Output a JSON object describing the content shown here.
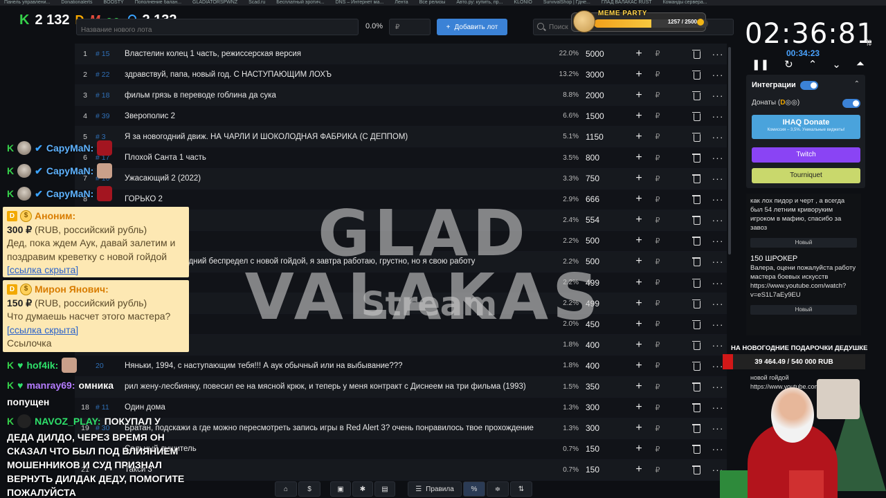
{
  "bookmarks": [
    "Панель управлени...",
    "Donationalerts",
    "BOOSTY",
    "Пополнение балан...",
    "GLADIATORSPWNZ",
    "Scad.ru",
    "Бесплатный эротич...",
    "DNS – Интернет ма...",
    "Лента",
    "Все релизы",
    "Авто.ру: купить, пр...",
    "KLONIO",
    "SurvivalShop | Гдне...",
    "ГЛАД ВАЛАКАС RUST",
    "Команды сервера..."
  ],
  "counters": {
    "left_value": "2 132",
    "right_value": "2 132"
  },
  "lot_form": {
    "name_placeholder": "Название нового лота",
    "percent": "0.0%",
    "currency": "₽",
    "add_button": "Добавить лот",
    "search_placeholder": "Поиск"
  },
  "meme_party": {
    "title": "MEME PARTY",
    "count": "1257 / 2500",
    "progress": 0.503
  },
  "table": {
    "rows": [
      {
        "n": "1",
        "id": "# 15",
        "name": "Властелин колец 1 часть, режиссерская версия",
        "pct": "22.0%",
        "amt": "5000"
      },
      {
        "n": "2",
        "id": "# 22",
        "name": "здравствуй, папа, новый год. С НАСТУПАЮЩИМ ЛОХЪ",
        "pct": "13.2%",
        "amt": "3000"
      },
      {
        "n": "3",
        "id": "# 18",
        "name": "фильм грязь в переводе гоблина да сука",
        "pct": "8.8%",
        "amt": "2000"
      },
      {
        "n": "4",
        "id": "# 39",
        "name": "Зверополис 2",
        "pct": "6.6%",
        "amt": "1500"
      },
      {
        "n": "5",
        "id": "# 3",
        "name": "Я за новогодний движ. НА ЧАРЛИ И ШОКОЛОДНАЯ ФАБРИКА (С ДЕППОМ)",
        "pct": "5.1%",
        "amt": "1150"
      },
      {
        "n": "6",
        "id": "# 17",
        "name": "Плохой Санта 1 часть",
        "pct": "3.5%",
        "amt": "800"
      },
      {
        "n": "7",
        "id": "# 10",
        "name": "Ужасающий 2 (2022)",
        "pct": "3.3%",
        "amt": "750"
      },
      {
        "n": "8",
        "id": "",
        "name": "ГОРЬКО 2",
        "pct": "2.9%",
        "amt": "666"
      },
      {
        "n": "",
        "id": "",
        "name": "итальянски 2003",
        "pct": "2.4%",
        "amt": "554"
      },
      {
        "n": "",
        "id": "",
        "name": "м совести 2016",
        "pct": "2.2%",
        "amt": "500"
      },
      {
        "n": "",
        "id": "",
        "name": "рублёвки. Новогодний беспредел с новой гойдой, я завтра работаю, грустно, но я свою работу",
        "pct": "2.2%",
        "amt": "500"
      },
      {
        "n": "",
        "id": "",
        "name": "",
        "pct": "2.2%",
        "amt": "499"
      },
      {
        "n": "",
        "id": "",
        "name": "",
        "pct": "2.2%",
        "amt": "499"
      },
      {
        "n": "",
        "id": "",
        "name": "стры на свободе",
        "pct": "2.0%",
        "amt": "450"
      },
      {
        "n": "",
        "id": "",
        "name": "",
        "pct": "1.8%",
        "amt": "400"
      },
      {
        "n": "",
        "id": "20",
        "name": "Няньки, 1994, с наступающим тебя!!! А аук обычный или на выбывание???",
        "pct": "1.8%",
        "amt": "400"
      },
      {
        "n": "",
        "id": "",
        "name": "рил жену-лесбиянку, повесил ее на мясной крюк, и теперь у меня контракт с Диснеем на три фильма (1993)",
        "pct": "1.5%",
        "amt": "350"
      },
      {
        "n": "18",
        "id": "# 11",
        "name": "Один дома",
        "pct": "1.3%",
        "amt": "300"
      },
      {
        "n": "19",
        "id": "# 30",
        "name": "Братан, подскажи а где можно пересмотреть запись игры в Red Alert 3? очень понравилось твое прохождение",
        "pct": "1.3%",
        "amt": "300"
      },
      {
        "n": "",
        "id": "",
        "name": "Сальный душитель",
        "pct": "0.7%",
        "amt": "150"
      },
      {
        "n": "21",
        "id": "",
        "name": "Такси 3",
        "pct": "0.7%",
        "amt": "150"
      }
    ],
    "plus": "+",
    "rub": "₽",
    "more": "···"
  },
  "watermark": {
    "title": "GLAD VALAKAS",
    "sub": "Stream"
  },
  "chat": {
    "capy": "CapyMaN:",
    "donations": [
      {
        "name": "Аноним:",
        "amount": "300 ₽",
        "currency_note": " (RUB, российский рубль)",
        "text": "Дед, пока ждем Аук, давай залетим и поздравим креветку с новой гойдой ",
        "link": "[ссылка скрыта]"
      },
      {
        "name": "Мирон Янович:",
        "amount": "150 ₽",
        "currency_note": " (RUB, российский рубль)",
        "text": "Что думаешь насчет этого мастера? ",
        "link": "[ссылка скрыта]",
        "tail": "Ссылочка"
      }
    ],
    "hof_nick": "hof4ik:",
    "manray_nick": "manray69:",
    "manray_msg": "омника",
    "manray_msg2": "попущен",
    "navoz_nick": "NAVOZ_PLAY:",
    "navoz_msg": "ПОКУПАЛ У",
    "big_msg": "ДЕДА ДИЛДО, ЧЕРЕЗ ВРЕМЯ ОН СКАЗАЛ ЧТО БЫЛ ПОД ВЛИЯНИЕМ МОШЕННИКОВ И СУД ПРИЗНАЛ ВЕРНУТЬ ДИЛДАК ДЕДУ, ПОМОГИТЕ ПОЖАЛУЙСТА"
  },
  "timer": {
    "main": "02:36:81",
    "sub": "00:34:23"
  },
  "integrations": {
    "title": "Интеграции",
    "donats_label": "Донаты (",
    "ihaq_title": "IHAQ Donate",
    "ihaq_sub": "Комиссия – 3,5%. Уникальные виджеты!",
    "twitch": "Twitch",
    "tourniquet": "Tourniquet"
  },
  "alerts": [
    {
      "text": "как лох пидор и черт , а всегда был 54 летним криворуким игроком в мафию, спасибо за завоз",
      "status": "Новый"
    },
    {
      "title": "150 ШРОКЕР",
      "text": "Валера, оцени пожалуйста работу мастера боевых искусств https://www.youtube.com/watch?v=eS1L7aEy9EU",
      "status": "Новый"
    },
    {
      "text": "новой гойдой https://www.youtube.com/mara"
    }
  ],
  "gift": {
    "title": "НА НОВОГОДНИЕ ПОДАРОЧКИ ДЕДУШКЕ",
    "progress": "39 464.49 / 540 000 RUB",
    "fraction": 0.073
  },
  "toolbar": {
    "rules": "Правила"
  }
}
